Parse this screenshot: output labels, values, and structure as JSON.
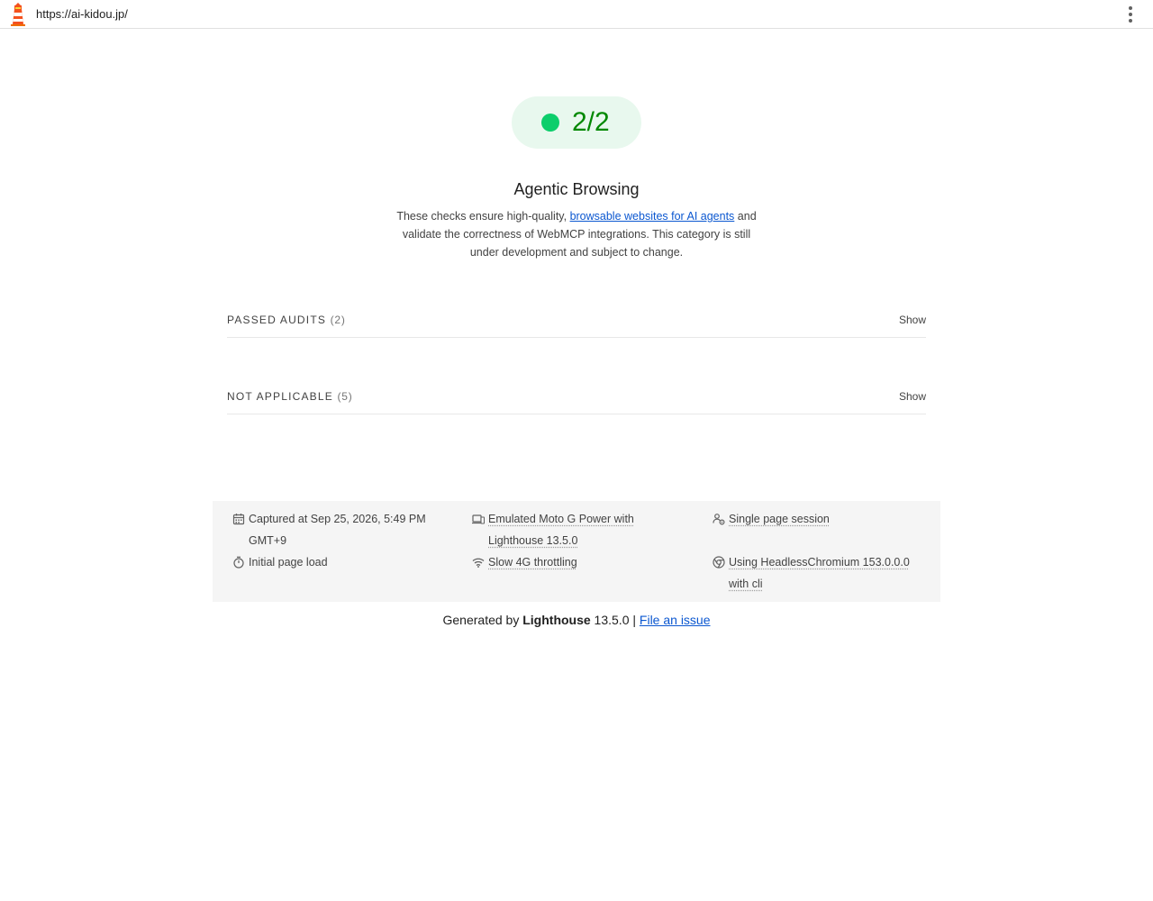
{
  "topbar": {
    "url": "https://ai-kidou.jp/",
    "logo_icon": "lighthouse-logo-icon",
    "menu_icon": "more-vertical-icon"
  },
  "score": {
    "value": "2/2",
    "color": "#008800",
    "dot_color": "#0cce6b"
  },
  "category": {
    "title": "Agentic Browsing",
    "desc_before": "These checks ensure high-quality, ",
    "desc_link": "browsable websites for AI agents",
    "desc_after": " and validate the correctness of WebMCP integrations. This category is still under development and subject to change."
  },
  "groups": {
    "passed": {
      "title": "PASSED AUDITS",
      "count": "(2)",
      "toggle": "Show"
    },
    "not_applicable": {
      "title": "NOT APPLICABLE",
      "count": "(5)",
      "toggle": "Show"
    }
  },
  "environment": {
    "captured": {
      "icon": "calendar-icon",
      "text": "Captured at Sep 25, 2026, 5:49 PM GMT+9"
    },
    "device": {
      "icon": "devices-icon",
      "text": "Emulated Moto G Power with Lighthouse 13.5.0"
    },
    "session": {
      "icon": "session-icon",
      "text": "Single page session"
    },
    "load": {
      "icon": "stopwatch-icon",
      "text": "Initial page load"
    },
    "throttling": {
      "icon": "wifi-icon",
      "text": "Slow 4G throttling"
    },
    "browser": {
      "icon": "chrome-icon",
      "text": "Using HeadlessChromium 153.0.0.0 with cli"
    }
  },
  "footer": {
    "prefix": "Generated by ",
    "brand": "Lighthouse",
    "version": " 13.5.0 | ",
    "issue_link": "File an issue"
  }
}
